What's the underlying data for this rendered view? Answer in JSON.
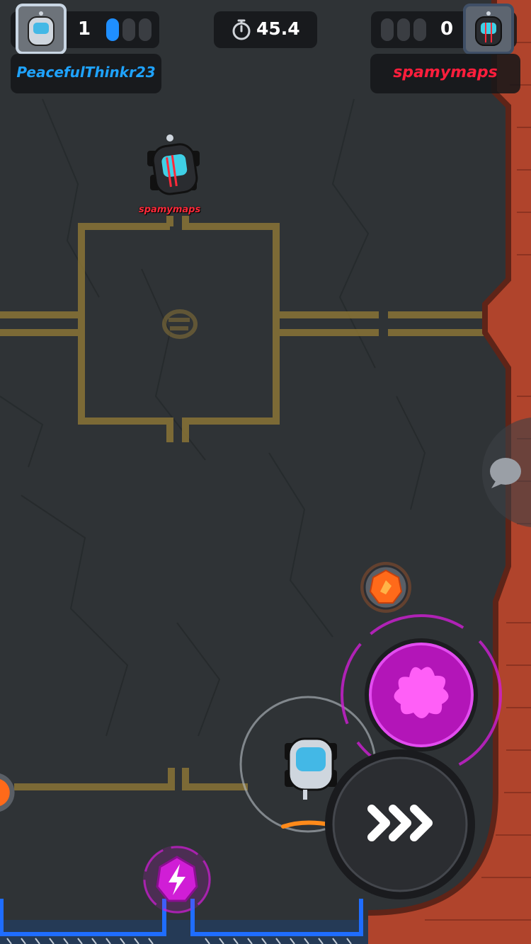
{
  "hud": {
    "left_player": {
      "name": "PeacefulThinkr23",
      "score": "1",
      "pips_filled": 1,
      "pips_total": 3,
      "name_color": "#1fa3ff"
    },
    "timer": {
      "value": "45.4",
      "icon": "stopwatch-icon"
    },
    "right_player": {
      "name": "spamymaps",
      "score": "0",
      "pips_filled": 0,
      "pips_total": 3,
      "name_color": "#ff1e3c"
    }
  },
  "field": {
    "opponent_car_label": "spamymaps",
    "colors": {
      "ground": "#2f3336",
      "lines": "#8a7436",
      "wall": "#b0442c",
      "player_blue": "#1f8fff",
      "opponent_red": "#ff2a3a",
      "power_magenta": "#d01ed6",
      "pickup_orange": "#ff6a1a"
    }
  },
  "controls": {
    "special_button_icon": "paint-splat-icon",
    "boost_button_icon": "triple-chevron-right-icon",
    "chat_button_icon": "chat-bubble-icon",
    "energy_pickup_icon": "lightning-bolt-icon",
    "boost_pickup_icon": "flame-icon"
  }
}
